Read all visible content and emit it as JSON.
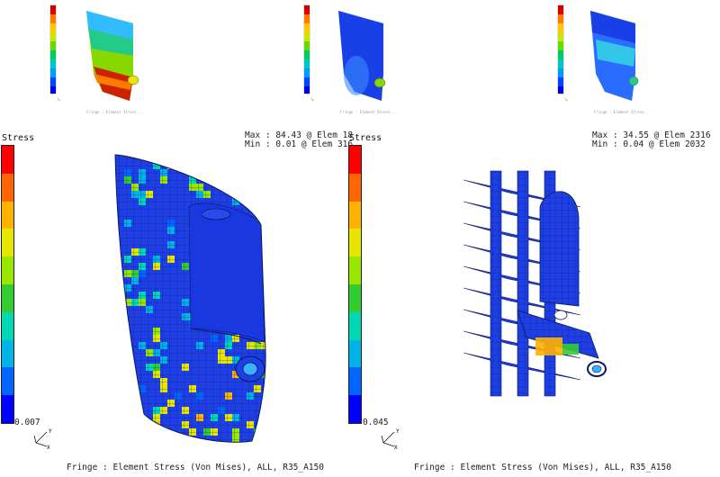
{
  "thumbnails": [
    {
      "caption": "Fringe : Element Stress..."
    },
    {
      "caption": "Fringe : Element Stress..."
    },
    {
      "caption": "Fringe : Element Stress..."
    }
  ],
  "views": [
    {
      "legend_title": "Stress",
      "max_text": "Max : 84.43 @ Elem 18",
      "min_text": "Min : 0.01 @ Elem 316",
      "scale_min": "0.007",
      "caption": "Fringe : Element Stress (Von Mises), ALL, R35_A150"
    },
    {
      "legend_title": "Stress",
      "max_text": "Max : 34.55 @ Elem 2316",
      "min_text": "Min : 0.04 @ Elem 2032",
      "scale_min": "0.045",
      "caption": "Fringe : Element Stress (Von Mises), ALL, R35_A150"
    }
  ],
  "fringe_colors": [
    "#ff0000",
    "#ff6600",
    "#ffb300",
    "#e6e600",
    "#99e600",
    "#33cc33",
    "#00d9b3",
    "#00b3e6",
    "#0066ff",
    "#0000ff"
  ],
  "axis_labels": {
    "y": "Y",
    "x": "X"
  }
}
